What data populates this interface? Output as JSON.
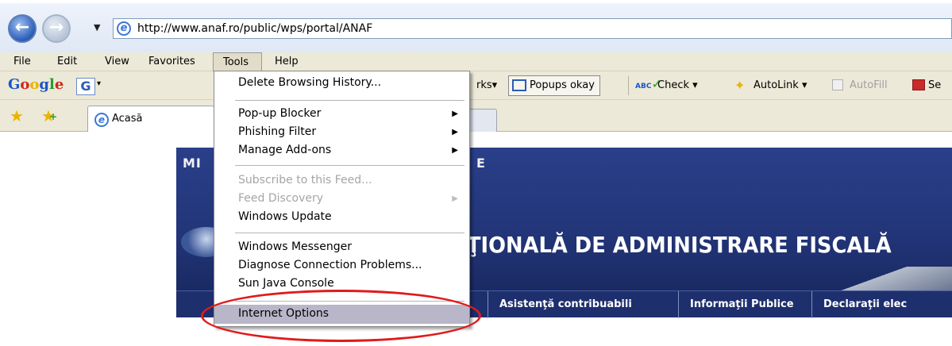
{
  "address_bar": {
    "url": "http://www.anaf.ro/public/wps/portal/ANAF",
    "back_label": "←",
    "forward_label": "→",
    "dropdown_glyph": "▼",
    "ie_glyph": "e"
  },
  "menubar": {
    "items": [
      "File",
      "Edit",
      "View",
      "Favorites",
      "Tools",
      "Help"
    ]
  },
  "google_toolbar": {
    "logo": [
      "G",
      "o",
      "o",
      "g",
      "l",
      "e"
    ],
    "search_glyph": "G",
    "dropdown_glyph": "▾",
    "bookmarks_fragment": "rks▾",
    "popups_label": "Popups okay",
    "check_label": "Check ▾",
    "check_icon_text": "ABC",
    "autolink_label": "AutoLink ▾",
    "autofill_label": "AutoFill",
    "send_label": "Se"
  },
  "tabs": {
    "active_tab_label": "Acasă",
    "fav_glyph": "★",
    "addfav_glyph": "★",
    "addfav_plus": "+"
  },
  "page": {
    "banner_top": "MI",
    "banner_top_right": "E",
    "banner_title": "AŢIONALĂ DE ADMINISTRARE FISCALĂ",
    "nav_links": [
      "Asistenţă contribuabili",
      "Informaţii Publice",
      "Declaraţii elec"
    ]
  },
  "tools_menu": {
    "delete_history": "Delete Browsing History...",
    "popup_blocker": "Pop-up Blocker",
    "phishing_filter": "Phishing Filter",
    "manage_addons": "Manage Add-ons",
    "subscribe_feed": "Subscribe to this Feed...",
    "feed_discovery": "Feed Discovery",
    "windows_update": "Windows Update",
    "windows_messenger": "Windows Messenger",
    "diagnose": "Diagnose Connection Problems...",
    "sun_java": "Sun Java Console",
    "internet_options": "Internet Options",
    "submenu_arrow": "▶"
  },
  "colors": {
    "annotation": "#e01b1b",
    "highlight": "#b9b6c9",
    "banner": "#223578"
  }
}
